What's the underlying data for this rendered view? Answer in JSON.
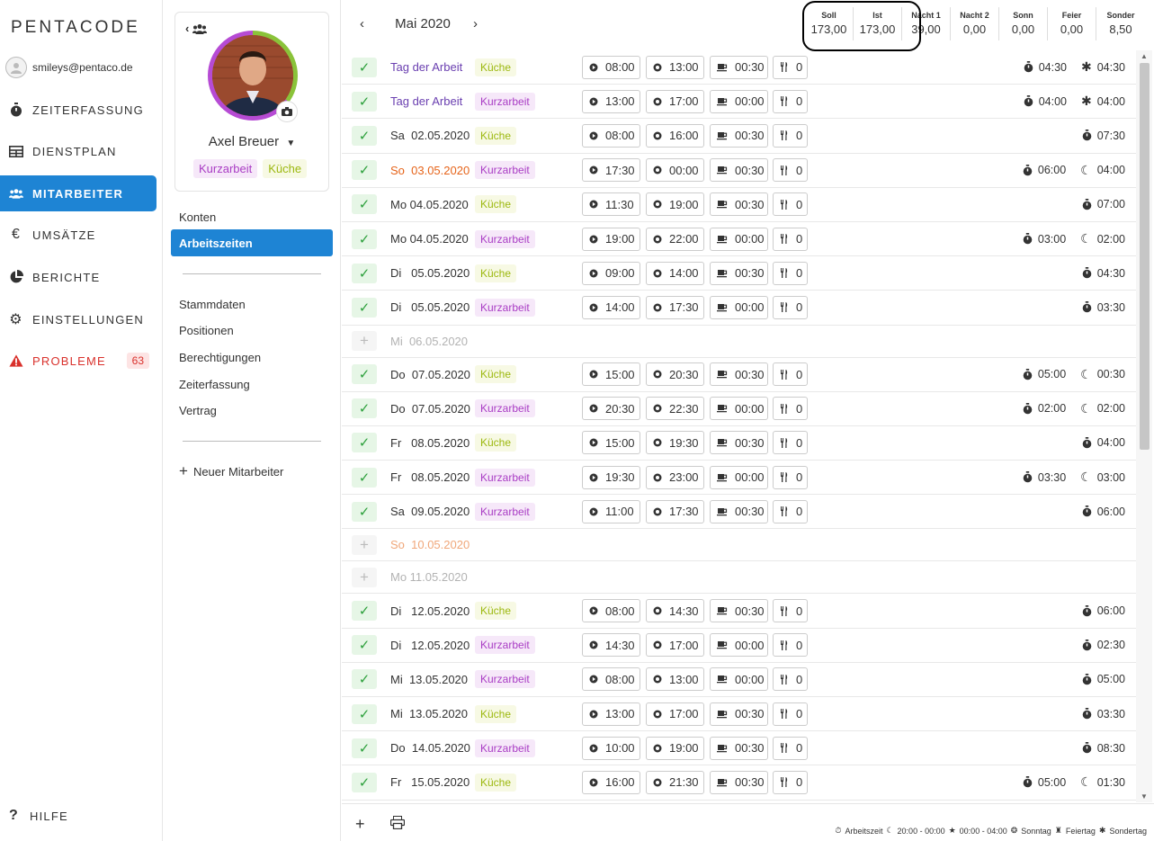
{
  "app": {
    "logo": "PENTACODE"
  },
  "user": {
    "email": "smileys@pentaco.de"
  },
  "nav": [
    {
      "label": "ZEITERFASSUNG",
      "icon": "stopwatch-icon"
    },
    {
      "label": "DIENSTPLAN",
      "icon": "table-icon"
    },
    {
      "label": "MITARBEITER",
      "icon": "users-icon",
      "active": true
    },
    {
      "label": "UMSÄTZE",
      "icon": "euro-icon"
    },
    {
      "label": "BERICHTE",
      "icon": "pie-chart-icon"
    },
    {
      "label": "EINSTELLUNGEN",
      "icon": "gear-icon"
    },
    {
      "label": "PROBLEME",
      "icon": "warning-icon",
      "badge": "63",
      "danger": true
    }
  ],
  "help": {
    "label": "HILFE"
  },
  "employee": {
    "name": "Axel Breuer",
    "tags": [
      "Kurzarbeit",
      "Küche"
    ],
    "menu_top": [
      "Konten",
      "Arbeitszeiten"
    ],
    "menu_mid": [
      "Stammdaten",
      "Positionen",
      "Berechtigungen",
      "Zeiterfassung",
      "Vertrag"
    ],
    "new_employee": "Neuer Mitarbeiter"
  },
  "month": {
    "label": "Mai 2020"
  },
  "stats": [
    {
      "h": "Soll",
      "v": "173,00"
    },
    {
      "h": "Ist",
      "v": "173,00"
    },
    {
      "h": "Nacht 1",
      "v": "39,00"
    },
    {
      "h": "Nacht 2",
      "v": "0,00"
    },
    {
      "h": "Sonn",
      "v": "0,00"
    },
    {
      "h": "Feier",
      "v": "0,00"
    },
    {
      "h": "Sonder",
      "v": "8,50"
    }
  ],
  "rows": [
    {
      "date": "Tag der Arbeit",
      "kind": "holiday",
      "tag": "Küche",
      "start": "08:00",
      "end": "13:00",
      "pause": "00:30",
      "meal": "0",
      "work": "04:30",
      "extra_icon": "asterisk",
      "extra": "04:30"
    },
    {
      "date": "Tag der Arbeit",
      "kind": "holiday",
      "tag": "Kurzarbeit",
      "start": "13:00",
      "end": "17:00",
      "pause": "00:00",
      "meal": "0",
      "work": "04:00",
      "extra_icon": "asterisk",
      "extra": "04:00"
    },
    {
      "date": "Sa  02.05.2020",
      "kind": "normal",
      "tag": "Küche",
      "start": "08:00",
      "end": "16:00",
      "pause": "00:30",
      "meal": "0",
      "work": "07:30"
    },
    {
      "date": "So  03.05.2020",
      "kind": "sunday",
      "tag": "Kurzarbeit",
      "start": "17:30",
      "end": "00:00",
      "pause": "00:30",
      "meal": "0",
      "work": "06:00",
      "extra_icon": "moon",
      "extra": "04:00"
    },
    {
      "date": "Mo 04.05.2020",
      "kind": "normal",
      "tag": "Küche",
      "start": "11:30",
      "end": "19:00",
      "pause": "00:30",
      "meal": "0",
      "work": "07:00"
    },
    {
      "date": "Mo 04.05.2020",
      "kind": "normal",
      "tag": "Kurzarbeit",
      "start": "19:00",
      "end": "22:00",
      "pause": "00:00",
      "meal": "0",
      "work": "03:00",
      "extra_icon": "moon",
      "extra": "02:00"
    },
    {
      "date": "Di   05.05.2020",
      "kind": "normal",
      "tag": "Küche",
      "start": "09:00",
      "end": "14:00",
      "pause": "00:30",
      "meal": "0",
      "work": "04:30"
    },
    {
      "date": "Di   05.05.2020",
      "kind": "normal",
      "tag": "Kurzarbeit",
      "start": "14:00",
      "end": "17:30",
      "pause": "00:00",
      "meal": "0",
      "work": "03:30"
    },
    {
      "date": "Mi  06.05.2020",
      "kind": "empty"
    },
    {
      "date": "Do  07.05.2020",
      "kind": "normal",
      "tag": "Küche",
      "start": "15:00",
      "end": "20:30",
      "pause": "00:30",
      "meal": "0",
      "work": "05:00",
      "extra_icon": "moon",
      "extra": "00:30"
    },
    {
      "date": "Do  07.05.2020",
      "kind": "normal",
      "tag": "Kurzarbeit",
      "start": "20:30",
      "end": "22:30",
      "pause": "00:00",
      "meal": "0",
      "work": "02:00",
      "extra_icon": "moon",
      "extra": "02:00"
    },
    {
      "date": "Fr   08.05.2020",
      "kind": "normal",
      "tag": "Küche",
      "start": "15:00",
      "end": "19:30",
      "pause": "00:30",
      "meal": "0",
      "work": "04:00"
    },
    {
      "date": "Fr   08.05.2020",
      "kind": "normal",
      "tag": "Kurzarbeit",
      "start": "19:30",
      "end": "23:00",
      "pause": "00:00",
      "meal": "0",
      "work": "03:30",
      "extra_icon": "moon",
      "extra": "03:00"
    },
    {
      "date": "Sa  09.05.2020",
      "kind": "normal",
      "tag": "Kurzarbeit",
      "start": "11:00",
      "end": "17:30",
      "pause": "00:30",
      "meal": "0",
      "work": "06:00"
    },
    {
      "date": "So  10.05.2020",
      "kind": "empty-sunday"
    },
    {
      "date": "Mo 11.05.2020",
      "kind": "empty"
    },
    {
      "date": "Di   12.05.2020",
      "kind": "normal",
      "tag": "Küche",
      "start": "08:00",
      "end": "14:30",
      "pause": "00:30",
      "meal": "0",
      "work": "06:00"
    },
    {
      "date": "Di   12.05.2020",
      "kind": "normal",
      "tag": "Kurzarbeit",
      "start": "14:30",
      "end": "17:00",
      "pause": "00:00",
      "meal": "0",
      "work": "02:30"
    },
    {
      "date": "Mi  13.05.2020",
      "kind": "normal",
      "tag": "Kurzarbeit",
      "start": "08:00",
      "end": "13:00",
      "pause": "00:00",
      "meal": "0",
      "work": "05:00"
    },
    {
      "date": "Mi  13.05.2020",
      "kind": "normal",
      "tag": "Küche",
      "start": "13:00",
      "end": "17:00",
      "pause": "00:30",
      "meal": "0",
      "work": "03:30"
    },
    {
      "date": "Do  14.05.2020",
      "kind": "normal",
      "tag": "Kurzarbeit",
      "start": "10:00",
      "end": "19:00",
      "pause": "00:30",
      "meal": "0",
      "work": "08:30"
    },
    {
      "date": "Fr   15.05.2020",
      "kind": "normal",
      "tag": "Küche",
      "start": "16:00",
      "end": "21:30",
      "pause": "00:30",
      "meal": "0",
      "work": "05:00",
      "extra_icon": "moon",
      "extra": "01:30"
    }
  ],
  "legend": {
    "arbeitszeit": "Arbeitszeit",
    "night1": "20:00 - 00:00",
    "night2": "00:00 - 04:00",
    "sunday": "Sonntag",
    "holiday": "Feiertag",
    "special": "Sondertag"
  },
  "colors": {
    "accent": "#1e84d4",
    "kurzarbeit": "#a93cc4",
    "kueche": "#9cb80f",
    "danger": "#d9312c"
  }
}
